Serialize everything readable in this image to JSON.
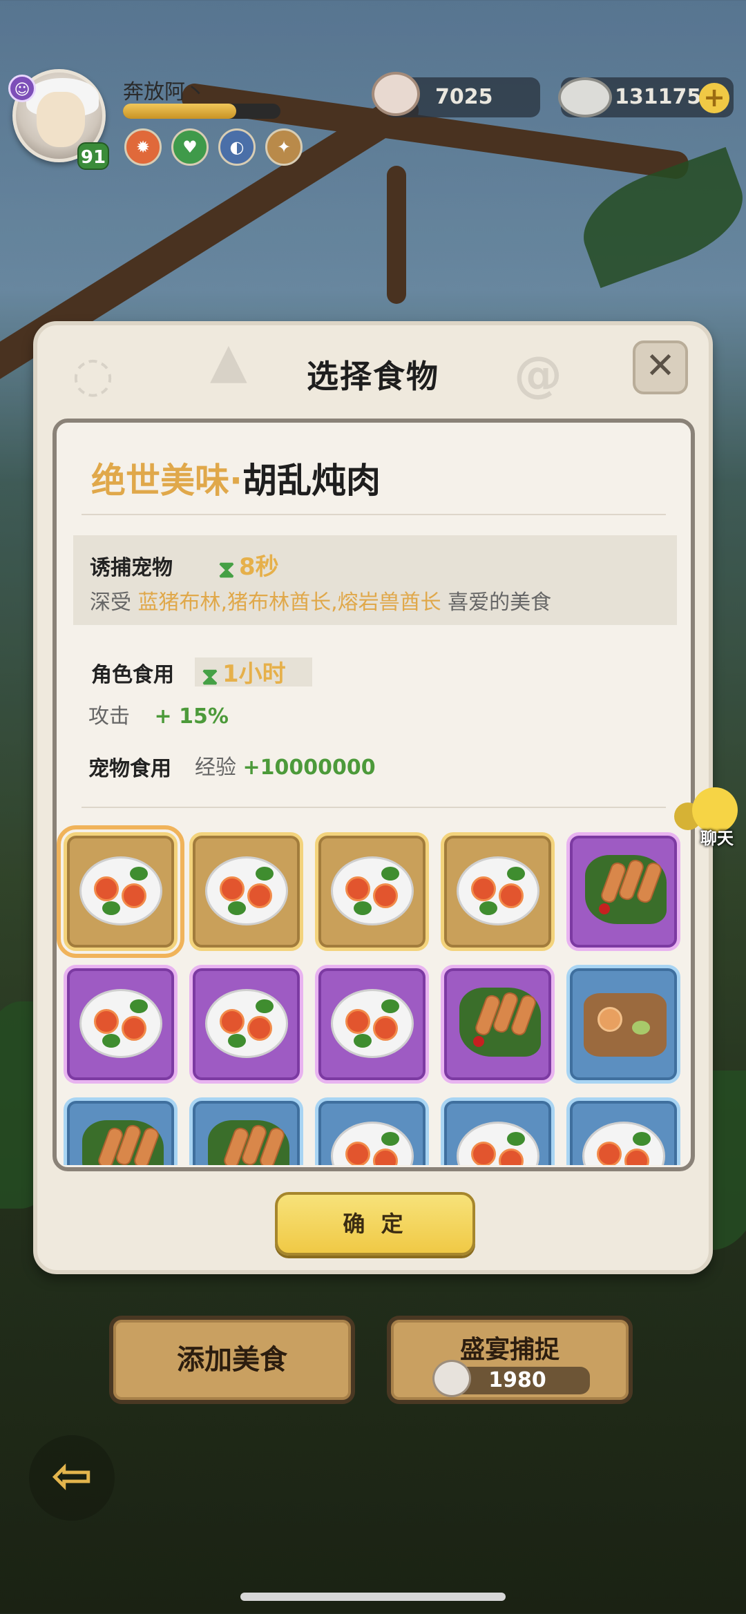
{
  "hud": {
    "player_name": "奔放阿丶",
    "level": "91",
    "xp_fraction": 0.72,
    "currency_shell": "7025",
    "currency_pearl": "131175",
    "plus_glyph": "+"
  },
  "dialog": {
    "title": "选择食物",
    "close_glyph": "✕",
    "food_quality": "绝世美味",
    "food_sep": "·",
    "food_name": "胡乱炖肉",
    "lure": {
      "label": "诱捕宠物",
      "duration": "8秒",
      "desc_prefix": "深受",
      "pets": "蓝猪布林,猪布林酋长,熔岩兽酋长",
      "desc_suffix": "喜爱的美食"
    },
    "role_eat": {
      "label": "角色食用",
      "duration": "1小时",
      "stat_name": "攻击",
      "stat_value": "+ 15%"
    },
    "pet_eat": {
      "label": "宠物食用",
      "stat_name": "经验",
      "stat_value": "+10000000"
    },
    "confirm_label": "确 定"
  },
  "food_grid": [
    {
      "rarity": "gold",
      "dish": "stew",
      "selected": true
    },
    {
      "rarity": "gold",
      "dish": "stew",
      "selected": false
    },
    {
      "rarity": "gold",
      "dish": "stew",
      "selected": false
    },
    {
      "rarity": "gold",
      "dish": "stew",
      "selected": false
    },
    {
      "rarity": "purple",
      "dish": "ribs",
      "selected": false
    },
    {
      "rarity": "purple",
      "dish": "stew",
      "selected": false
    },
    {
      "rarity": "purple",
      "dish": "stew",
      "selected": false
    },
    {
      "rarity": "purple",
      "dish": "stew",
      "selected": false
    },
    {
      "rarity": "purple",
      "dish": "ribs",
      "selected": false
    },
    {
      "rarity": "blue",
      "dish": "seafood",
      "selected": false
    },
    {
      "rarity": "blue",
      "dish": "ribs",
      "selected": false
    },
    {
      "rarity": "blue",
      "dish": "ribs",
      "selected": false
    },
    {
      "rarity": "blue",
      "dish": "stew",
      "selected": false
    },
    {
      "rarity": "blue",
      "dish": "stew",
      "selected": false
    },
    {
      "rarity": "blue",
      "dish": "stew",
      "selected": false
    }
  ],
  "chat_label": "聊天",
  "bottom": {
    "add_food": "添加美食",
    "feast_capture": "盛宴捕捉",
    "feast_cost": "1980"
  },
  "back_glyph": "⇦",
  "colors": {
    "gold_text": "#e0a84a",
    "green_text": "#4c9a3a",
    "rarity_gold": "#c9a05a",
    "rarity_purple": "#9e5bc3",
    "rarity_blue": "#5c8fc0"
  }
}
